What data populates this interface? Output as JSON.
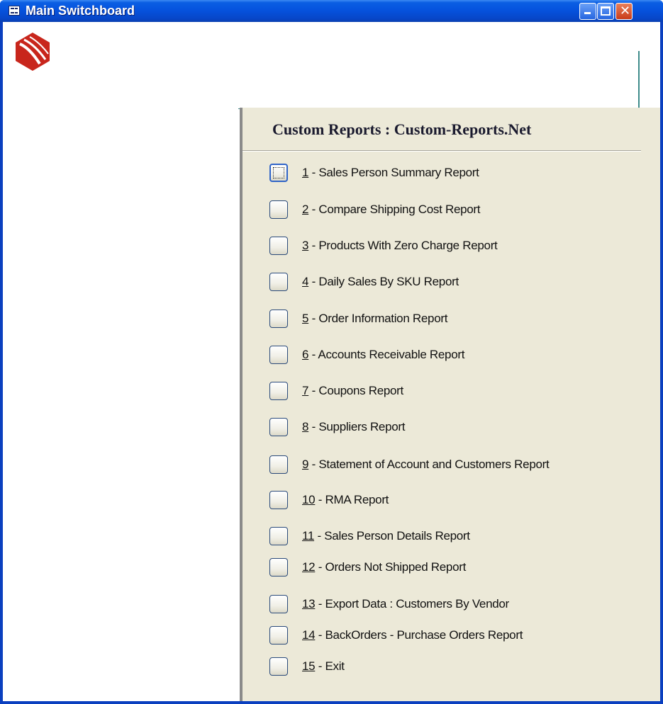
{
  "window": {
    "title": "Main Switchboard"
  },
  "panel": {
    "title": "Custom Reports : Custom-Reports.Net"
  },
  "menu": {
    "items": [
      {
        "num": "1",
        "label": " - Sales Person Summary Report",
        "focused": true
      },
      {
        "num": "2",
        "label": " - Compare Shipping Cost Report"
      },
      {
        "num": "3",
        "label": " - Products With Zero Charge Report"
      },
      {
        "num": "4",
        "label": " - Daily Sales By SKU Report"
      },
      {
        "num": "5",
        "label": " - Order Information Report"
      },
      {
        "num": "6",
        "label": " - Accounts Receivable Report"
      },
      {
        "num": "7",
        "label": " - Coupons Report"
      },
      {
        "num": "8",
        "label": " - Suppliers Report"
      },
      {
        "num": "9",
        "label": " - Statement of Account and Customers Report"
      },
      {
        "num": "10",
        "label": " - RMA Report"
      },
      {
        "num": "11",
        "label": " - Sales Person Details Report"
      },
      {
        "num": "12",
        "label": " - Orders Not Shipped Report"
      },
      {
        "num": "13",
        "label": " - Export Data : Customers By Vendor"
      },
      {
        "num": "14",
        "label": " - BackOrders - Purchase Orders Report"
      },
      {
        "num": "15",
        "label": " - Exit"
      }
    ]
  },
  "colors": {
    "titlebar": "#0653de",
    "panel_bg": "#ece9d8",
    "logo_red": "#c8261c"
  }
}
